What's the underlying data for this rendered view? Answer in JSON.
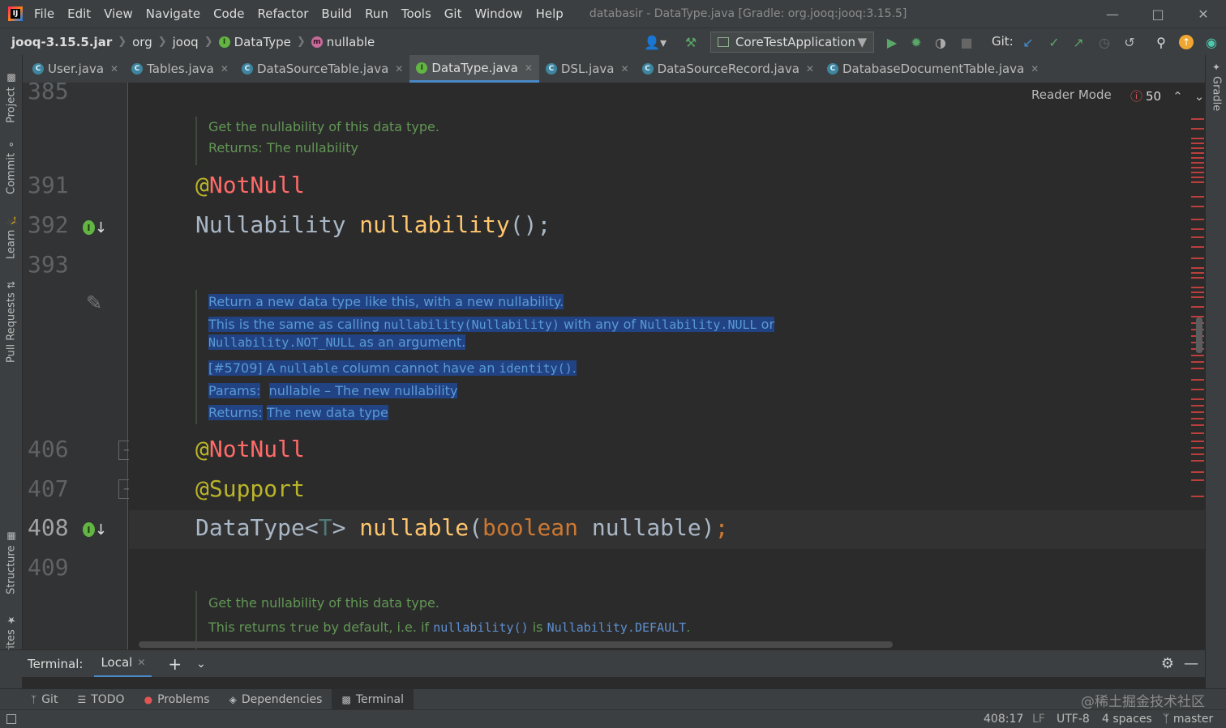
{
  "menu": [
    "File",
    "Edit",
    "View",
    "Navigate",
    "Code",
    "Refactor",
    "Build",
    "Run",
    "Tools",
    "Git",
    "Window",
    "Help"
  ],
  "window_title": "databasir - DataType.java [Gradle: org.jooq:jooq:3.15.5]",
  "breadcrumb": {
    "jar": "jooq-3.15.5.jar",
    "p1": "org",
    "p2": "jooq",
    "cls": "DataType",
    "member": "nullable"
  },
  "toolbar": {
    "run_config": "CoreTestApplication",
    "git_label": "Git:"
  },
  "tabs": [
    {
      "label": "User.java"
    },
    {
      "label": "Tables.java"
    },
    {
      "label": "DataSourceTable.java"
    },
    {
      "label": "DataType.java"
    },
    {
      "label": "DSL.java"
    },
    {
      "label": "DataSourceRecord.java"
    },
    {
      "label": "DatabaseDocumentTable.java"
    }
  ],
  "left_tools": {
    "project": "Project",
    "commit": "Commit",
    "learn": "Learn",
    "pull_requests": "Pull Requests",
    "structure": "Structure",
    "favorites": "Favorites"
  },
  "right_tools": {
    "gradle": "Gradle"
  },
  "editor": {
    "reader_mode": "Reader Mode",
    "error_count": "50",
    "line_numbers": {
      "l385": "385",
      "l391": "391",
      "l392": "392",
      "l393": "393",
      "l406": "406",
      "l407": "407",
      "l408": "408",
      "l409": "409"
    },
    "doc1": {
      "l1": "Get the nullability of this data type.",
      "l2": "Returns: The nullability"
    },
    "code391": {
      "at": "@",
      "name": "NotNull"
    },
    "code392": {
      "type": "Nullability",
      "method": "nullability",
      "rest": "();"
    },
    "doc2": {
      "l1": "Return a new data type like this, with a new nullability.",
      "l2a": "This is the same as calling ",
      "l2b": "nullability(Nullability)",
      "l2c": " with any of ",
      "l2d": "Nullability.NULL",
      "l2e": " or",
      "l3a": "Nullability.NOT_NULL",
      "l3b": " as an argument.",
      "l4a": "[#5709] A ",
      "l4b": "nullable",
      "l4c": " column cannot have an ",
      "l4d": "identity()",
      "l4e": ".",
      "params_label": "Params:",
      "params_value": "nullable – The new nullability",
      "returns_label": "Returns:",
      "returns_value": "The new data type"
    },
    "code406": {
      "at": "@",
      "name": "NotNull"
    },
    "code407": {
      "text": "@Support"
    },
    "code408": {
      "type": "DataType",
      "lt": "<",
      "tp": "T",
      "gt": "> ",
      "method": "nullable",
      "po": "(",
      "kw": "boolean",
      "param": " nullable",
      "pc": ")",
      "semi": ";"
    },
    "doc3": {
      "l1": "Get the nullability of this data type.",
      "l2a": "This returns ",
      "l2b": "true",
      "l2c": " by default, i.e. if ",
      "l2d": "nullability()",
      "l2e": " is ",
      "l2f": "Nullability.DEFAULT",
      "l2g": "."
    }
  },
  "terminal": {
    "label": "Terminal:",
    "tab": "Local"
  },
  "bottom_tools": [
    {
      "label": "Git"
    },
    {
      "label": "TODO"
    },
    {
      "label": "Problems"
    },
    {
      "label": "Dependencies"
    },
    {
      "label": "Terminal"
    }
  ],
  "status": {
    "position": "408:17",
    "line_sep": "LF",
    "encoding": "UTF-8",
    "indent": "4 spaces",
    "branch": "master"
  },
  "watermark": "@稀土掘金技术社区"
}
